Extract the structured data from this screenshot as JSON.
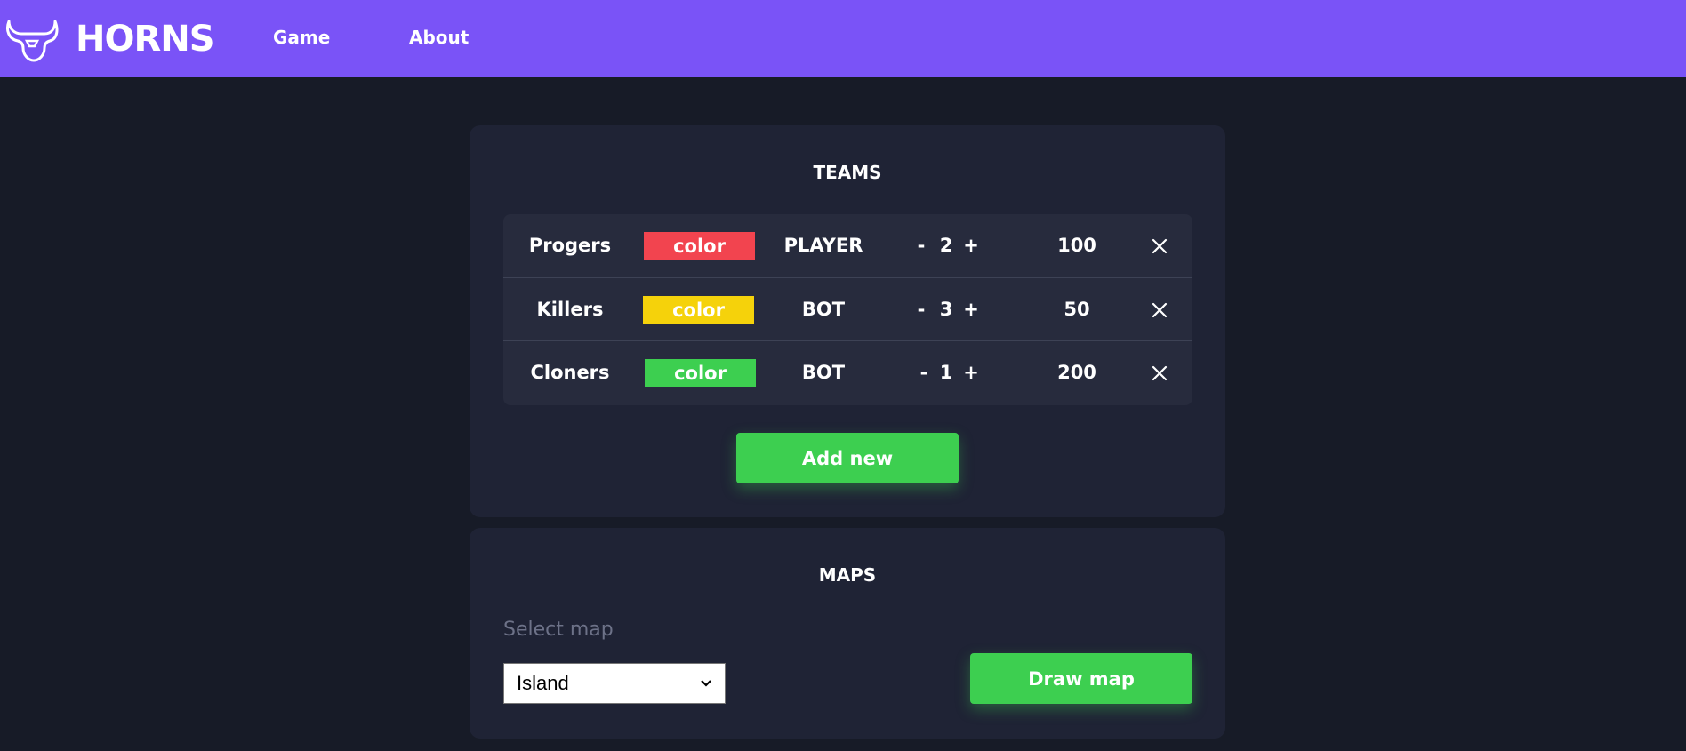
{
  "header": {
    "brand": "HORNS",
    "nav": [
      {
        "label": "Game"
      },
      {
        "label": "About"
      }
    ],
    "color": "#7a53f7"
  },
  "teams_card": {
    "title": "TEAMS",
    "teams": [
      {
        "name": "Progers",
        "color_label": "color",
        "color": "#f2444f",
        "type": "PLAYER",
        "minus": "-",
        "count": "2",
        "plus": "+",
        "score": "100"
      },
      {
        "name": "Killers",
        "color_label": "color",
        "color": "#f5d20b",
        "type": "BOT",
        "minus": "-",
        "count": "3",
        "plus": "+",
        "score": "50"
      },
      {
        "name": "Cloners",
        "color_label": "color",
        "color": "#3dcf50",
        "type": "BOT",
        "minus": "-",
        "count": "1",
        "plus": "+",
        "score": "200"
      }
    ],
    "add_button": "Add new"
  },
  "maps_card": {
    "title": "MAPS",
    "select_label": "Select map",
    "selected_map": "Island",
    "draw_button": "Draw map"
  },
  "colors": {
    "background": "#171b27",
    "card": "#1f2335",
    "accent_green": "#3dcf50"
  }
}
